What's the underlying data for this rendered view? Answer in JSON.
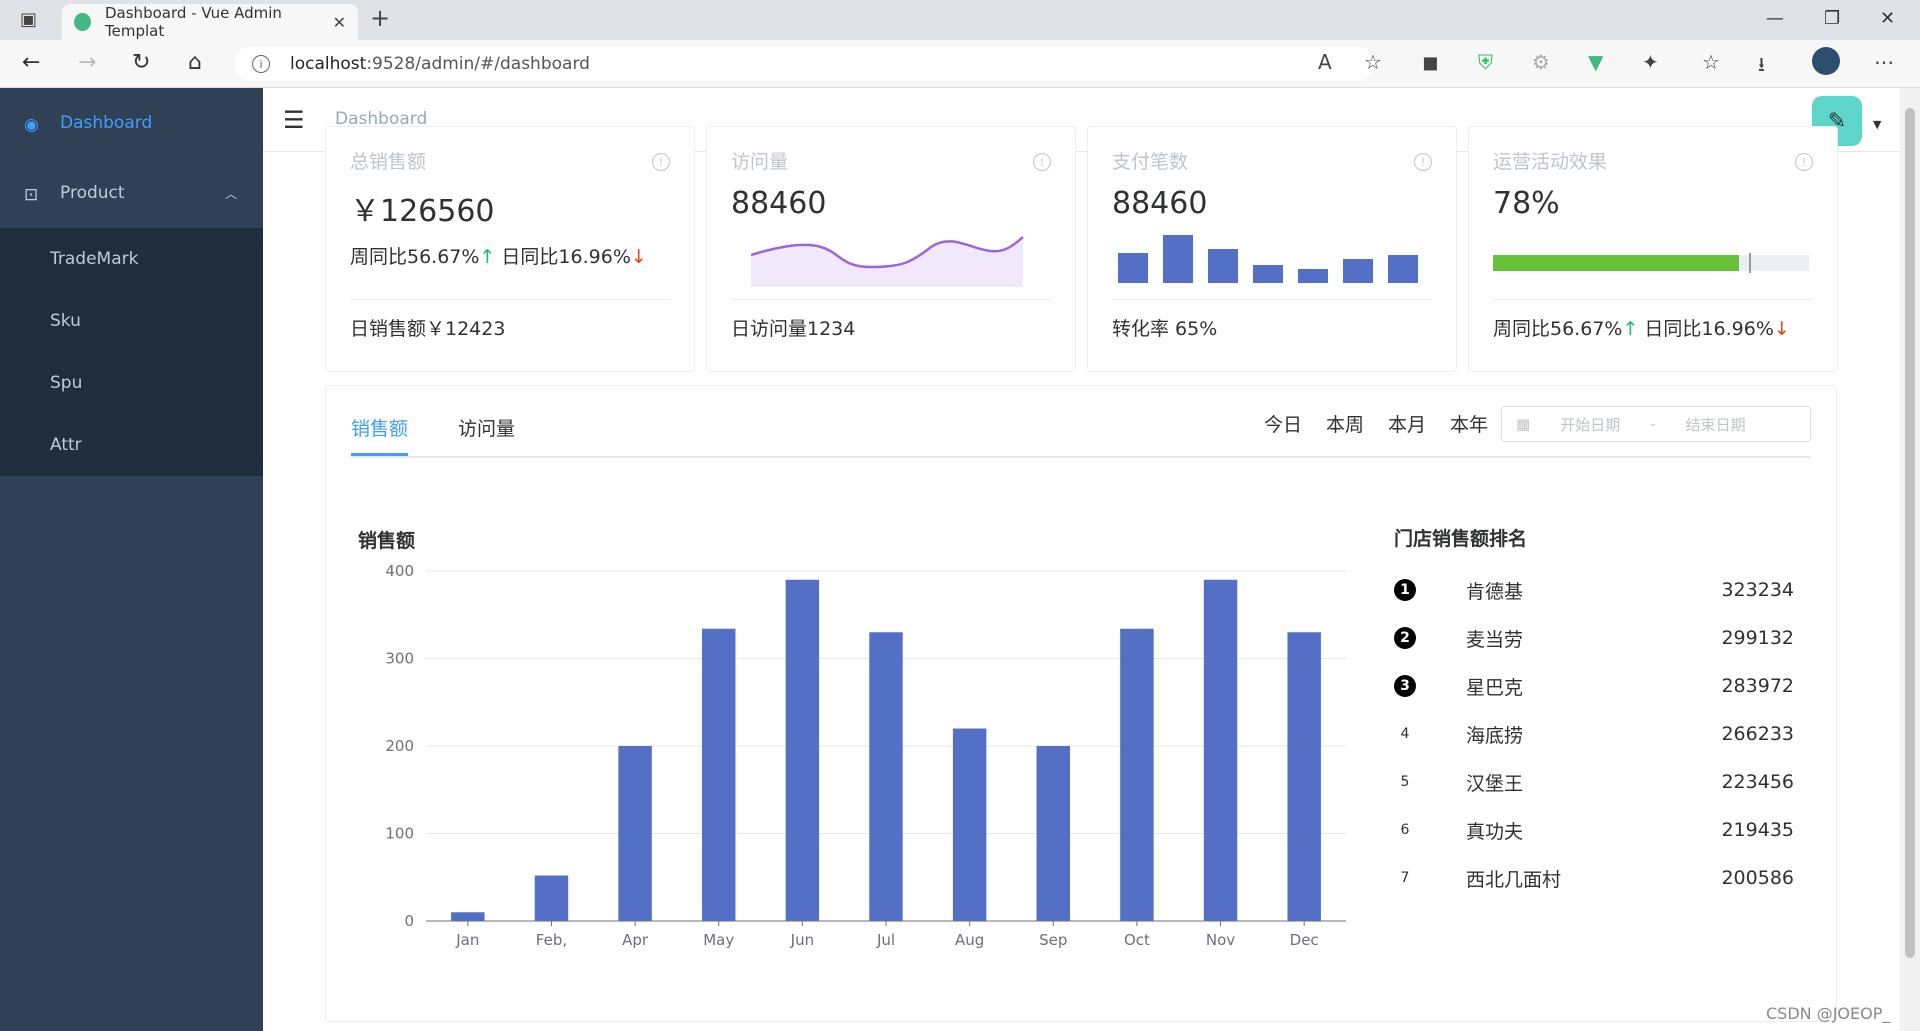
{
  "browser": {
    "tab_title": "Dashboard - Vue Admin Templat",
    "url_host": "localhost",
    "url_rest": ":9528/admin/#/dashboard"
  },
  "sidebar": {
    "items": [
      {
        "label": "Dashboard",
        "icon": "dashboard-icon"
      },
      {
        "label": "Product",
        "icon": "bag-icon"
      }
    ],
    "sub": [
      {
        "label": "TradeMark"
      },
      {
        "label": "Sku"
      },
      {
        "label": "Spu"
      },
      {
        "label": "Attr"
      }
    ]
  },
  "header": {
    "breadcrumb": "Dashboard"
  },
  "kpis": [
    {
      "title": "总销售额",
      "value": "￥126560",
      "week": "周同比56.67%",
      "week_arrow": "↑",
      "day": "日同比16.96%",
      "day_arrow": "↓",
      "foot": "日销售额￥12423"
    },
    {
      "title": "访问量",
      "value": "88460",
      "foot": "日访问量1234"
    },
    {
      "title": "支付笔数",
      "value": "88460",
      "foot": "转化率 65%"
    },
    {
      "title": "运营活动效果",
      "value": "78%",
      "progress": 0.78,
      "week": "周同比56.67%",
      "week_arrow": "↑",
      "day": "日同比16.96%",
      "day_arrow": "↓"
    }
  ],
  "sales": {
    "tabs": [
      "销售额",
      "访问量"
    ],
    "ranges": [
      "今日",
      "本周",
      "本月",
      "本年"
    ],
    "start_placeholder": "开始日期",
    "sep": "-",
    "end_placeholder": "结束日期"
  },
  "chart_data": {
    "type": "bar",
    "title": "销售额",
    "categories": [
      "Jan",
      "Feb,",
      "Apr",
      "May",
      "Jun",
      "Jul",
      "Aug",
      "Sep",
      "Oct",
      "Nov",
      "Dec"
    ],
    "values": [
      10,
      52,
      200,
      334,
      390,
      330,
      220,
      200,
      334,
      390,
      330
    ],
    "ylim": [
      0,
      400
    ],
    "yticks": [
      0,
      100,
      200,
      300,
      400
    ],
    "color": "#5470c6"
  },
  "ranking": {
    "title": "门店销售额排名",
    "rows": [
      {
        "rank": "1",
        "name": "肯德基",
        "value": "323234"
      },
      {
        "rank": "2",
        "name": "麦当劳",
        "value": "299132"
      },
      {
        "rank": "3",
        "name": "星巴克",
        "value": "283972"
      },
      {
        "rank": "4",
        "name": "海底捞",
        "value": "266233"
      },
      {
        "rank": "5",
        "name": "汉堡王",
        "value": "223456"
      },
      {
        "rank": "6",
        "name": "真功夫",
        "value": "219435"
      },
      {
        "rank": "7",
        "name": "西北几面村",
        "value": "200586"
      }
    ]
  },
  "watermark": "CSDN @JOEOP_"
}
